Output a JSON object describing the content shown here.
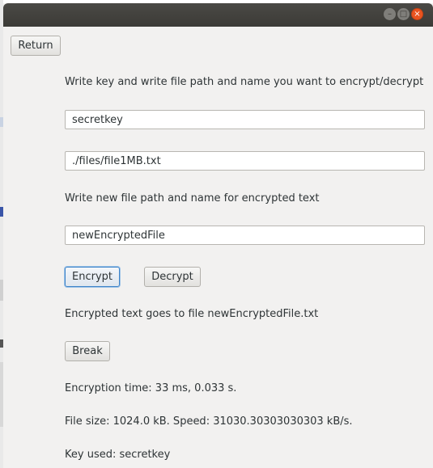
{
  "window": {
    "controls": {
      "minimize_icon": "–",
      "maximize_icon": "□",
      "close_icon": "×"
    }
  },
  "toolbar": {
    "return_label": "Return"
  },
  "form": {
    "instruction": "Write key and write file path and name you want to encrypt/decrypt",
    "key_value": "secretkey",
    "file_path_value": "./files/file1MB.txt",
    "new_file_instruction": "Write new file path and name for encrypted text",
    "new_file_value": "newEncryptedFile"
  },
  "actions": {
    "encrypt_label": "Encrypt",
    "decrypt_label": "Decrypt",
    "break_label": "Break"
  },
  "results": {
    "output_message": "Encrypted text goes to file newEncryptedFile.txt",
    "encryption_time": "Encryption time: 33 ms, 0.033 s.",
    "file_size_speed": "File size: 1024.0 kB. Speed: 31030.30303030303 kB/s.",
    "key_used": "Key used: secretkey"
  },
  "colors": {
    "titlebar": "#3c3b37",
    "close_button": "#e95420",
    "focus_ring": "#3d83c8",
    "window_bg": "#f2f1f0"
  }
}
